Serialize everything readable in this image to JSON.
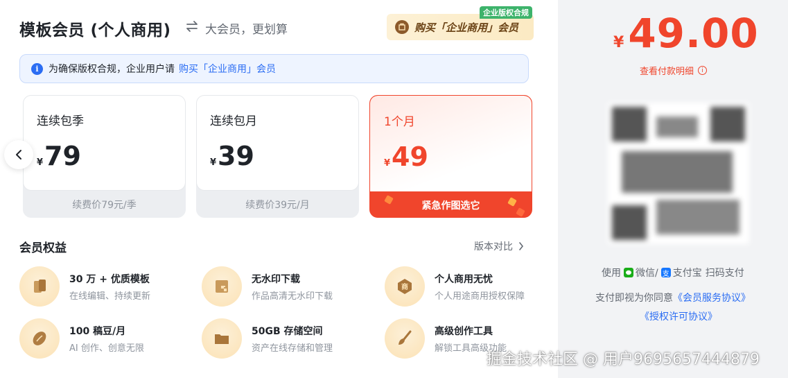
{
  "header": {
    "title": "模板会员 (个人商用)",
    "subtitle": "大会员，更划算",
    "biz_button_label": "购买「企业商用」会员",
    "biz_tag": "企业版权合规"
  },
  "notice": {
    "text": "为确保版权合规，企业用户请",
    "link": "购买「企业商用」会员"
  },
  "plans": [
    {
      "name": "连续包季",
      "currency": "¥",
      "price": "79",
      "footer": "续费价79元/季",
      "selected": false
    },
    {
      "name": "连续包月",
      "currency": "¥",
      "price": "39",
      "footer": "续费价39元/月",
      "selected": false
    },
    {
      "name": "1个月",
      "currency": "¥",
      "price": "49",
      "footer": "紧急作图选它",
      "selected": true
    }
  ],
  "benefits": {
    "title": "会员权益",
    "compare_label": "版本对比",
    "items": [
      {
        "title": "30 万 + 优质模板",
        "desc": "在线编辑、持续更新",
        "icon": "template-icon"
      },
      {
        "title": "无水印下载",
        "desc": "作品高清无水印下载",
        "icon": "no-watermark-icon"
      },
      {
        "title": "个人商用无忧",
        "desc": "个人用途商用授权保障",
        "icon": "commercial-icon"
      },
      {
        "title": "100 稿豆/月",
        "desc": "AI 创作、创意无限",
        "icon": "bean-icon"
      },
      {
        "title": "50GB 存储空间",
        "desc": "资产在线存储和管理",
        "icon": "folder-icon"
      },
      {
        "title": "高级创作工具",
        "desc": "解锁工具高级功能",
        "icon": "brush-icon"
      }
    ]
  },
  "payment": {
    "currency": "¥",
    "total": "49.00",
    "detail_label": "查看付款明细",
    "pay_prefix": "使用",
    "wechat": "微信/",
    "alipay": "支付宝",
    "pay_suffix": "扫码支付",
    "agree_text": "支付即视为你同意",
    "agreement1": "《会员服务协议》",
    "agreement2": "《授权许可协议》"
  },
  "watermark": "掘金技术社区 @ 用户9695657444879",
  "colors": {
    "accent": "#f0452c",
    "link": "#2b6df3",
    "gold": "#8c5a2b"
  }
}
